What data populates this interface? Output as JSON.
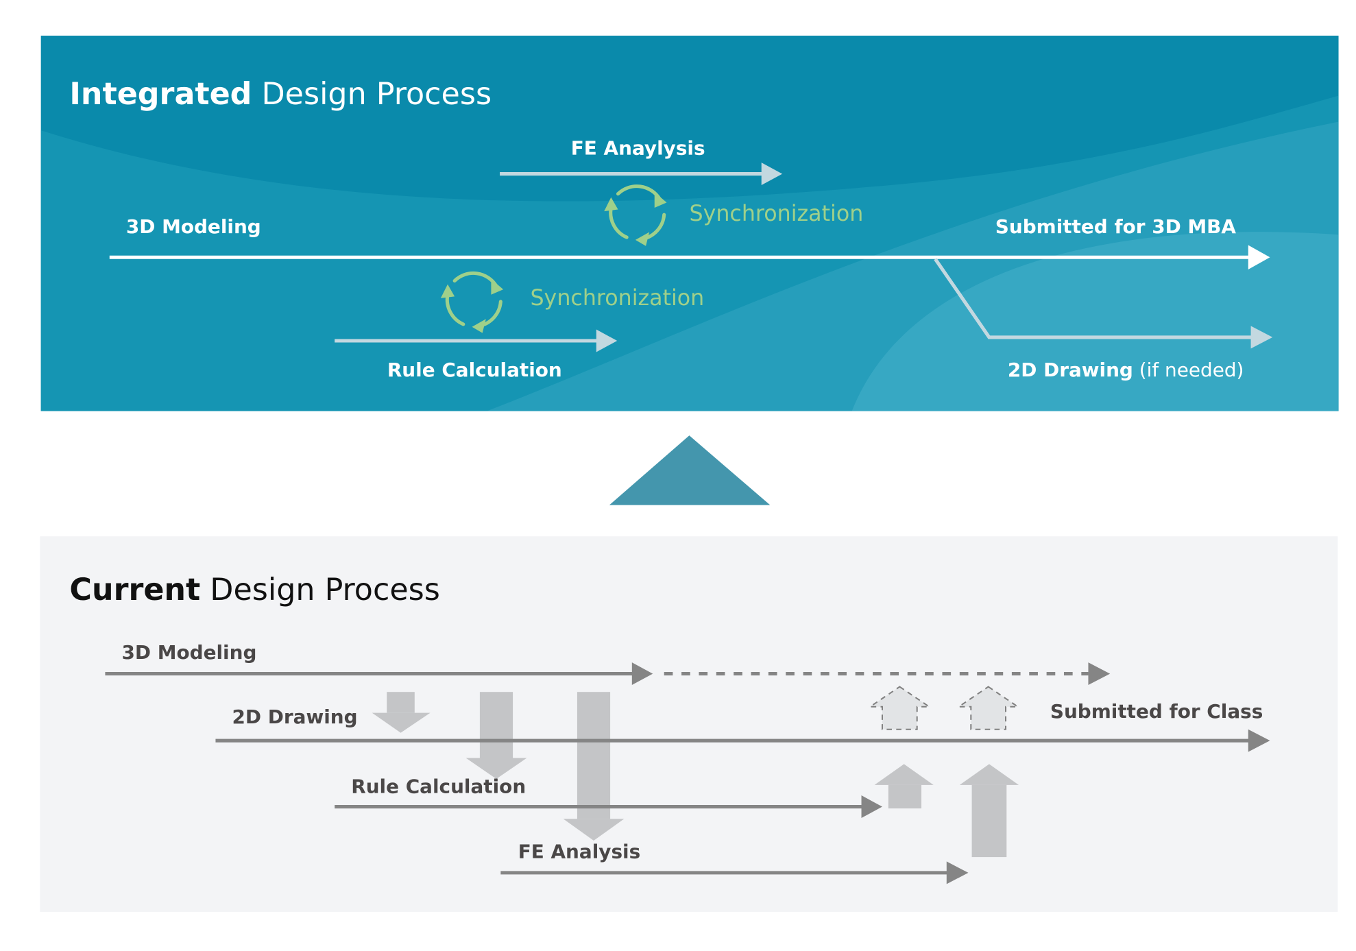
{
  "integrated": {
    "title_bold": "Integrated",
    "title_rest": " Design Process",
    "labels": {
      "fe_analysis": "FE Anaylysis",
      "modeling": "3D Modeling",
      "submitted": "Submitted for 3D MBA",
      "rule_calculation": "Rule Calculation",
      "drawing_bold": "2D Drawing",
      "drawing_note": " (if needed)",
      "sync_upper": "Synchronization",
      "sync_lower": "Synchronization"
    },
    "colors": {
      "panel": "#0a8aab",
      "panel_light": "#35a5c1",
      "sync": "#9fd08a",
      "arrow_main": "#ffffff",
      "arrow_secondary": "#c3d8e0"
    }
  },
  "transition": {
    "icon": "up-triangle-icon",
    "color": "#4496ad"
  },
  "current": {
    "title_bold": "Current",
    "title_rest": " Design Process",
    "labels": {
      "modeling": "3D Modeling",
      "drawing": "2D Drawing",
      "rule_calculation": "Rule Calculation",
      "fe_analysis": "FE Analysis",
      "submitted": "Submitted for Class"
    },
    "colors": {
      "panel": "#f3f4f6",
      "line": "#858585",
      "block_arrow": "#c4c5c7",
      "text": "#4a4747"
    }
  }
}
